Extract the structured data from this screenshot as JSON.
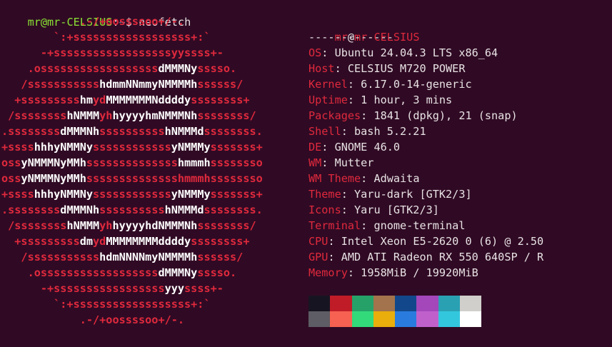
{
  "prompt": {
    "user_host": "mr@mr-CELSIUS",
    "colon": ":",
    "path": "~",
    "symbol": "$ ",
    "command": "neofetch"
  },
  "logo": [
    [
      [
        "r",
        "            .-/+oossssoo+/-."
      ]
    ],
    [
      [
        "r",
        "        `:+ssssssssssssssssss+:`"
      ]
    ],
    [
      [
        "r",
        "      -+ssssssssssssssssssyyssss+-"
      ]
    ],
    [
      [
        "r",
        "    .ossssssssssssssssss"
      ],
      [
        "w",
        "dMMMNy"
      ],
      [
        "r",
        "sssso."
      ]
    ],
    [
      [
        "r",
        "   /sssssssssss"
      ],
      [
        "w",
        "hdmmNNmmyNMMMMh"
      ],
      [
        "r",
        "ssssss/"
      ]
    ],
    [
      [
        "r",
        "  +sssssssss"
      ],
      [
        "w",
        "hm"
      ],
      [
        "r",
        "yd"
      ],
      [
        "w",
        "MMMMMMMNddddy"
      ],
      [
        "r",
        "ssssssss+"
      ]
    ],
    [
      [
        "r",
        " /ssssssss"
      ],
      [
        "w",
        "hNMMM"
      ],
      [
        "r",
        "yh"
      ],
      [
        "w",
        "hyyyyhmNMMMNh"
      ],
      [
        "r",
        "ssssssss/"
      ]
    ],
    [
      [
        "r",
        ".ssssssss"
      ],
      [
        "w",
        "dMMMNh"
      ],
      [
        "r",
        "ssssssssss"
      ],
      [
        "w",
        "hNMMMd"
      ],
      [
        "r",
        "ssssssss."
      ]
    ],
    [
      [
        "r",
        "+ssss"
      ],
      [
        "w",
        "hhhyNMMNy"
      ],
      [
        "r",
        "ssssssssssss"
      ],
      [
        "w",
        "yNMMMy"
      ],
      [
        "r",
        "sssssss+"
      ]
    ],
    [
      [
        "r",
        "oss"
      ],
      [
        "w",
        "yNMMMNyMMh"
      ],
      [
        "r",
        "ssssssssssssss"
      ],
      [
        "w",
        "hmmmh"
      ],
      [
        "r",
        "ssssssso"
      ]
    ],
    [
      [
        "r",
        "oss"
      ],
      [
        "w",
        "yNMMMNyMMh"
      ],
      [
        "r",
        "sssssssssssssshmmmhssssssso"
      ]
    ],
    [
      [
        "r",
        "+ssss"
      ],
      [
        "w",
        "hhhyNMMNy"
      ],
      [
        "r",
        "ssssssssssss"
      ],
      [
        "w",
        "yNMMMy"
      ],
      [
        "r",
        "sssssss+"
      ]
    ],
    [
      [
        "r",
        ".ssssssss"
      ],
      [
        "w",
        "dMMMNh"
      ],
      [
        "r",
        "ssssssssss"
      ],
      [
        "w",
        "hNMMMd"
      ],
      [
        "r",
        "ssssssss."
      ]
    ],
    [
      [
        "r",
        " /ssssssss"
      ],
      [
        "w",
        "hNMMM"
      ],
      [
        "r",
        "yh"
      ],
      [
        "w",
        "hyyyyhdNMMMNh"
      ],
      [
        "r",
        "ssssssss/"
      ]
    ],
    [
      [
        "r",
        "  +sssssssss"
      ],
      [
        "w",
        "dm"
      ],
      [
        "r",
        "yd"
      ],
      [
        "w",
        "MMMMMMMMddddy"
      ],
      [
        "r",
        "ssssssss+"
      ]
    ],
    [
      [
        "r",
        "   /sssssssssss"
      ],
      [
        "w",
        "hdmNNNNmyNMMMMh"
      ],
      [
        "r",
        "ssssss/"
      ]
    ],
    [
      [
        "r",
        "    .ossssssssssssssssss"
      ],
      [
        "w",
        "dMMMNy"
      ],
      [
        "r",
        "sssso."
      ]
    ],
    [
      [
        "r",
        "      -+sssssssssssssssss"
      ],
      [
        "w",
        "yyy"
      ],
      [
        "r",
        "ssss+-"
      ]
    ],
    [
      [
        "r",
        "        `:+ssssssssssssssssss+:`"
      ]
    ],
    [
      [
        "r",
        "            .-/+oossssoo+/-."
      ]
    ]
  ],
  "info": {
    "title_user": "mr",
    "title_at": "@",
    "title_host": "mr-CELSIUS",
    "separator": "-------------",
    "rows": [
      {
        "label": "OS",
        "value": "Ubuntu 24.04.3 LTS x86_64"
      },
      {
        "label": "Host",
        "value": "CELSIUS M720 POWER"
      },
      {
        "label": "Kernel",
        "value": "6.17.0-14-generic"
      },
      {
        "label": "Uptime",
        "value": "1 hour, 3 mins"
      },
      {
        "label": "Packages",
        "value": "1841 (dpkg), 21 (snap)"
      },
      {
        "label": "Shell",
        "value": "bash 5.2.21"
      },
      {
        "label": "DE",
        "value": "GNOME 46.0"
      },
      {
        "label": "WM",
        "value": "Mutter"
      },
      {
        "label": "WM Theme",
        "value": "Adwaita"
      },
      {
        "label": "Theme",
        "value": "Yaru-dark [GTK2/3]"
      },
      {
        "label": "Icons",
        "value": "Yaru [GTK2/3]"
      },
      {
        "label": "Terminal",
        "value": "gnome-terminal"
      },
      {
        "label": "CPU",
        "value": "Intel Xeon E5-2620 0 (6) @ 2.50"
      },
      {
        "label": "GPU",
        "value": "AMD ATI Radeon RX 550 640SP / R"
      },
      {
        "label": "Memory",
        "value": "1958MiB / 19920MiB"
      }
    ],
    "label_suffix": ": "
  },
  "palette": {
    "normal": [
      "#171421",
      "#c01c28",
      "#26a269",
      "#a2734c",
      "#12488b",
      "#a347ba",
      "#2aa1b3",
      "#d0cfcc"
    ],
    "bright": [
      "#5e5c64",
      "#f66151",
      "#33da7a",
      "#e9ad0c",
      "#2a7bde",
      "#c061cb",
      "#33c7de",
      "#ffffff"
    ]
  },
  "colors": {
    "background": "#300a24",
    "accent_red": "#e0293d",
    "prompt_green": "#8ae234",
    "prompt_blue": "#729fcf"
  }
}
